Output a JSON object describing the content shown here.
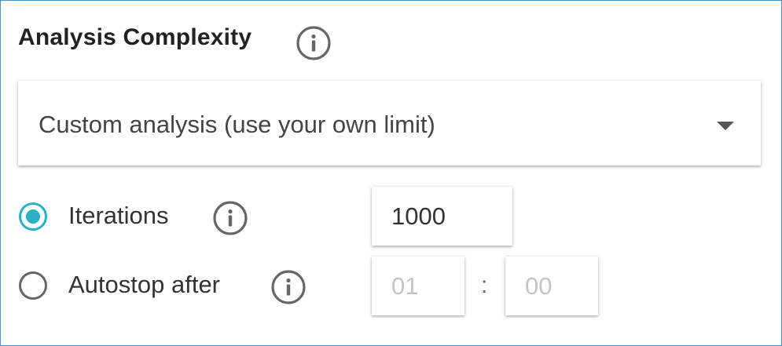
{
  "section": {
    "title": "Analysis Complexity",
    "info_icon": "info-icon"
  },
  "complexity_select": {
    "selected_value": "Custom analysis (use your own limit)",
    "arrow_icon": "caret-down-icon"
  },
  "options": {
    "iterations": {
      "label": "Iterations",
      "checked": true,
      "value": "1000"
    },
    "autostop": {
      "label": "Autostop after",
      "checked": false,
      "hours_placeholder": "01",
      "separator": ":",
      "minutes_placeholder": "00"
    }
  },
  "colors": {
    "accent": "#2bb0c8",
    "border": "#4a8fc7",
    "placeholder": "#c4c4c4"
  }
}
